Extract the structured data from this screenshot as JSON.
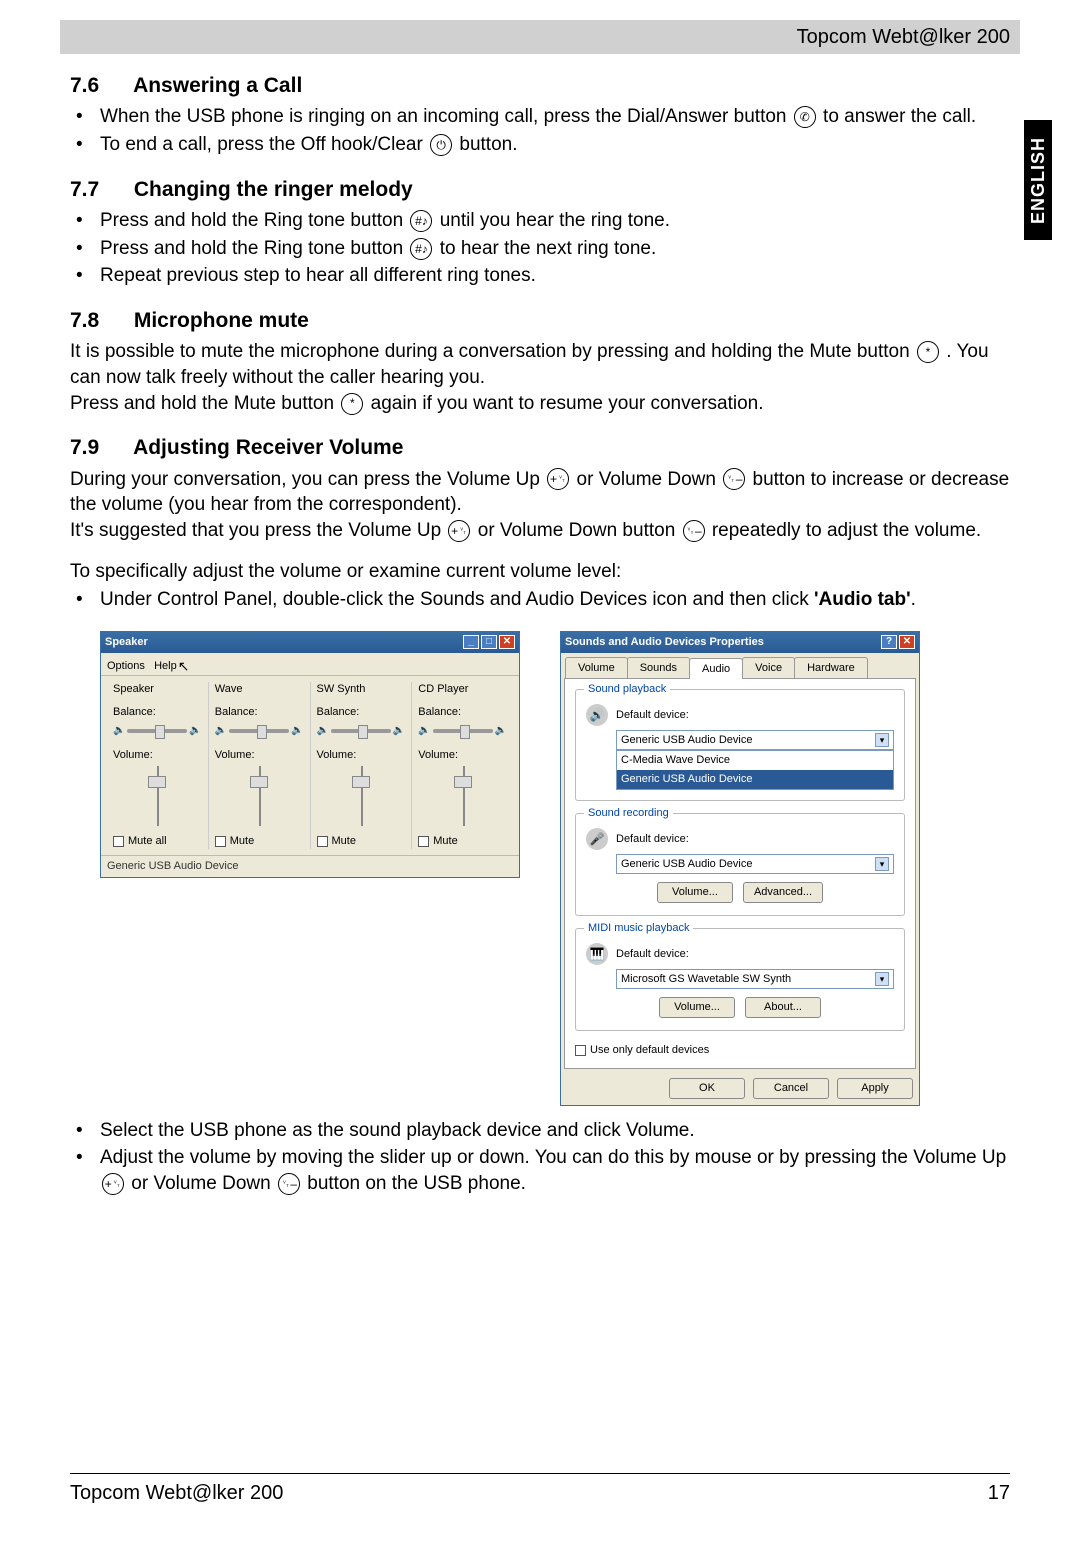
{
  "header": {
    "title": "Topcom Webt@lker 200"
  },
  "sidetab": {
    "label": "ENGLISH"
  },
  "s76": {
    "num": "7.6",
    "title": "Answering a Call",
    "b1a": "When the USB phone is ringing on an incoming call, press the Dial/Answer button ",
    "b1b": " to answer the call.",
    "b2a": "To end a call, press the Off hook/Clear ",
    "b2b": " button."
  },
  "s77": {
    "num": "7.7",
    "title": "Changing the ringer melody",
    "b1a": "Press and hold the Ring tone button ",
    "b1b": " until you hear the ring tone.",
    "b2a": "Press and hold the Ring tone button ",
    "b2b": " to hear the next ring tone.",
    "b3": "Repeat previous step to hear all different ring tones."
  },
  "s78": {
    "num": "7.8",
    "title": "Microphone mute",
    "p1a": "It is possible to mute the microphone during a conversation by pressing and holding the Mute button ",
    "p1b": ". You can now talk freely without the caller hearing you.",
    "p2a": "Press and hold the Mute button ",
    "p2b": " again if you want to resume your conversation."
  },
  "s79": {
    "num": "7.9",
    "title": "Adjusting Receiver Volume",
    "p1a": "During your conversation, you can press the Volume Up ",
    "p1b": " or Volume Down ",
    "p1c": " button to increase or decrease the volume (you hear from the correspondent).",
    "p2a": "It's suggested that you press the Volume Up ",
    "p2b": " or Volume Down button ",
    "p2c": " repeatedly to adjust the volume.",
    "p3": "To specifically adjust the volume or examine current volume level:",
    "b1a": "Under Control Panel, double-click the Sounds and Audio Devices icon and then click ",
    "b1b": "'Audio tab'",
    "b1c": "."
  },
  "speaker": {
    "title": "Speaker",
    "menu_options": "Options",
    "menu_help": "Help",
    "cols": [
      "Speaker",
      "Wave",
      "SW Synth",
      "CD Player"
    ],
    "balance": "Balance:",
    "volume": "Volume:",
    "mute_all": "Mute all",
    "mute": "Mute",
    "status": "Generic USB Audio Device"
  },
  "props": {
    "title": "Sounds and Audio Devices Properties",
    "tabs": [
      "Volume",
      "Sounds",
      "Audio",
      "Voice",
      "Hardware"
    ],
    "playback": {
      "group": "Sound playback",
      "label": "Default device:",
      "selected": "Generic USB Audio Device",
      "options": [
        "C-Media Wave Device",
        "Generic USB Audio Device"
      ]
    },
    "recording": {
      "group": "Sound recording",
      "label": "Default device:",
      "selected": "Generic USB Audio Device",
      "volume_btn": "Volume...",
      "advanced_btn": "Advanced..."
    },
    "midi": {
      "group": "MIDI music playback",
      "label": "Default device:",
      "selected": "Microsoft GS Wavetable SW Synth",
      "volume_btn": "Volume...",
      "about_btn": "About..."
    },
    "use_only": "Use only default devices",
    "ok": "OK",
    "cancel": "Cancel",
    "apply": "Apply"
  },
  "after": {
    "b1": "Select the USB phone as the sound playback device and click Volume.",
    "b2a": "Adjust the volume by moving the slider up or down. You can do this by mouse or by pressing the Volume Up ",
    "b2b": " or Volume Down ",
    "b2c": " button on the USB phone."
  },
  "footer": {
    "left": "Topcom Webt@lker 200",
    "right": "17"
  },
  "icons": {
    "dial": "✆",
    "offhook": "⏻",
    "hash": "#♪",
    "mute": "*",
    "volup": "+␋",
    "voldown": "␋–"
  }
}
